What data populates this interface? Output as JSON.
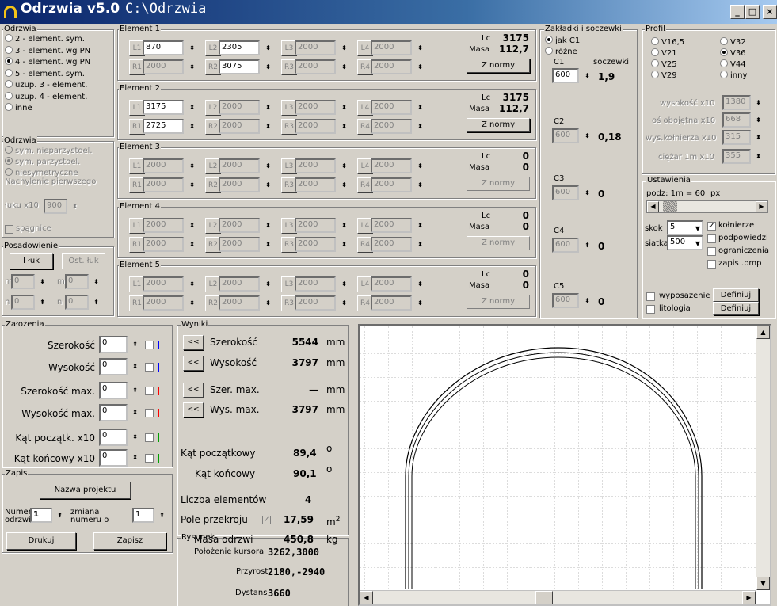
{
  "window": {
    "app": "Odrzwia v5.0",
    "path": "C:\\Odrzwia",
    "min": "_",
    "max": "□",
    "close": "×"
  },
  "typ": {
    "title": "Odrzwia",
    "options": [
      "2 - element. sym.",
      "3 - element. wg PN",
      "4 - element. wg PN",
      "5 - element. sym.",
      "uzup. 3 - element.",
      "uzup. 4 - element.",
      "inne"
    ],
    "selected": 2
  },
  "sym": {
    "title": "Odrzwia",
    "options": [
      "sym. nieparzystoel.",
      "sym. parzystoel.",
      "niesymetryczne"
    ],
    "selected": 1,
    "nachylenie_label1": "Nachylenie pierwszego",
    "nachylenie_label2": "łuku x10",
    "nachylenie_value": "900",
    "spagnice": "spągnice"
  },
  "posad": {
    "title": "Posadowienie",
    "btn1": "I łuk",
    "btn2": "Ost. łuk",
    "m1": "m",
    "m1v": "0",
    "m2": "m",
    "m2v": "0",
    "n1": "n",
    "n1v": "0",
    "n2": "n",
    "n2v": "0"
  },
  "elements": [
    {
      "title": "Element 1",
      "L": [
        "870",
        "2305",
        "2000",
        "2000"
      ],
      "R": [
        "2000",
        "3075",
        "2000",
        "2000"
      ],
      "lc_label": "Lc",
      "lc": "3175",
      "masa_label": "Masa",
      "masa": "112,7",
      "btn": "Z normy"
    },
    {
      "title": "Element 2",
      "L": [
        "3175",
        "2000",
        "2000",
        "2000"
      ],
      "R": [
        "2725",
        "2000",
        "2000",
        "2000"
      ],
      "lc_label": "Lc",
      "lc": "3175",
      "masa_label": "Masa",
      "masa": "112,7",
      "btn": "Z normy"
    },
    {
      "title": "Element 3",
      "L": [
        "2000",
        "2000",
        "2000",
        "2000"
      ],
      "R": [
        "2000",
        "2000",
        "2000",
        "2000"
      ],
      "lc_label": "Lc",
      "lc": "0",
      "masa_label": "Masa",
      "masa": "0",
      "btn": "Z normy"
    },
    {
      "title": "Element 4",
      "L": [
        "2000",
        "2000",
        "2000",
        "2000"
      ],
      "R": [
        "2000",
        "2000",
        "2000",
        "2000"
      ],
      "lc_label": "Lc",
      "lc": "0",
      "masa_label": "Masa",
      "masa": "0",
      "btn": "Z normy"
    },
    {
      "title": "Element 5",
      "L": [
        "2000",
        "2000",
        "2000",
        "2000"
      ],
      "R": [
        "2000",
        "2000",
        "2000",
        "2000"
      ],
      "lc_label": "Lc",
      "lc": "0",
      "masa_label": "Masa",
      "masa": "0",
      "btn": "Z normy"
    }
  ],
  "btn_labels": {
    "L": [
      "L1",
      "L2",
      "L3",
      "L4"
    ],
    "R": [
      "R1",
      "R2",
      "R3",
      "R4"
    ]
  },
  "zakladki": {
    "title": "Zakładki i soczewki",
    "jak": "jak C1",
    "rozne": "różne",
    "c1": "C1",
    "soczewki": "soczewki",
    "c1_value": "600",
    "c1_res": "1,9",
    "c2": "C2",
    "c2_value": "600",
    "c2_res": "0,18",
    "c3": "C3",
    "c3_value": "600",
    "c3_res": "0",
    "c4": "C4",
    "c4_value": "600",
    "c4_res": "0",
    "c5": "C5",
    "c5_value": "600",
    "c5_res": "0"
  },
  "profil": {
    "title": "Profil",
    "options": [
      "V16,5",
      "V32",
      "V21",
      "V36",
      "V25",
      "V44",
      "V29",
      "inny"
    ],
    "selected": 3,
    "wys_label": "wysokość x10",
    "wys": "1380",
    "os_label": "oś obojętna x10",
    "os": "668",
    "kol_label": "wys.kołnierza x10",
    "kol": "315",
    "ciezar_label": "ciężar 1m x10",
    "ciezar": "355"
  },
  "ustawienia": {
    "title": "Ustawienia",
    "podz": "podz: 1m = 60",
    "px": "px",
    "skok_label": "skok",
    "skok": "5",
    "siatka_label": "siatka",
    "siatka": "500",
    "kolnierze": "kołnierze",
    "podpowiedzi": "podpowiedzi",
    "ograniczenia": "ograniczenia",
    "zapis": "zapis .bmp",
    "wyposazenie": "wyposażenie",
    "litologia": "litologia",
    "definiuj1": "Definiuj",
    "definiuj2": "Definiuj"
  },
  "zalozenia": {
    "title": "Założenia",
    "rows": [
      {
        "label": "Szerokość",
        "value": "0",
        "color": "#0000ff"
      },
      {
        "label": "Wysokość",
        "value": "0",
        "color": "#0000ff"
      },
      {
        "label": "Szerokość max.",
        "value": "0",
        "color": "#ff0000"
      },
      {
        "label": "Wysokość max.",
        "value": "0",
        "color": "#ff0000"
      },
      {
        "label": "Kąt początk. x10",
        "value": "0",
        "color": "#00a000"
      },
      {
        "label": "Kąt końcowy x10",
        "value": "0",
        "color": "#00a000"
      }
    ]
  },
  "zapis": {
    "title": "Zapis",
    "nazwa": "Nazwa projektu",
    "numer1": "Numer",
    "numer2": "odrzwi",
    "numer_value": "1",
    "zmiana1": "zmiana",
    "zmiana2": "numeru o",
    "zmiana_value": "1",
    "drukuj": "Drukuj",
    "zapisz": "Zapisz"
  },
  "wyniki": {
    "title": "Wyniki",
    "back": "<<",
    "rows": [
      {
        "label": "Szerokość",
        "value": "5544",
        "unit": "mm"
      },
      {
        "label": "Wysokość",
        "value": "3797",
        "unit": "mm"
      },
      {
        "label": "Szer. max.",
        "value": "—",
        "unit": "mm"
      },
      {
        "label": "Wys. max.",
        "value": "3797",
        "unit": "mm"
      }
    ],
    "kat_pocz": "Kąt początkowy",
    "kat_pocz_v": "89,4",
    "kat_kon": "Kąt końcowy",
    "kat_kon_v": "90,1",
    "deg": "o",
    "liczba": "Liczba elementów",
    "liczba_v": "4",
    "pole": "Pole przekroju",
    "pole_v": "17,59",
    "pole_u": "m",
    "sq": "2",
    "masa": "Masa odrzwi",
    "masa_v": "450,8",
    "masa_u": "kg"
  },
  "rysunek": {
    "title": "Rysunek",
    "pol": "Położenie kursora",
    "pol_v": "3262,3000",
    "przyrost": "Przyrost",
    "przyrost_v": "2180,-2940",
    "dystans": "Dystans",
    "dystans_v": "3660"
  }
}
